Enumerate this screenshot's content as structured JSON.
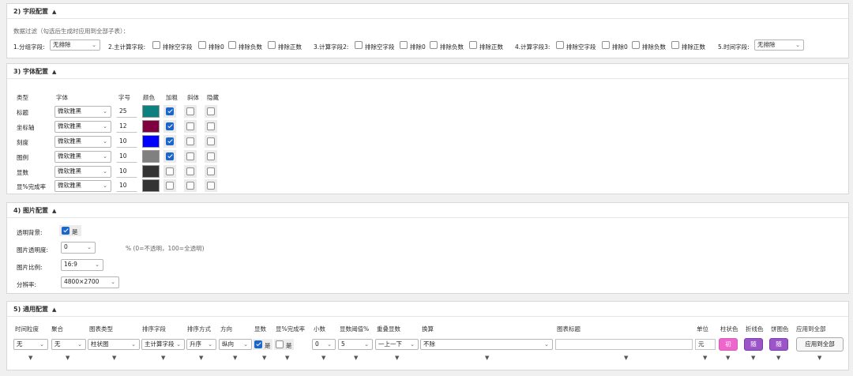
{
  "field_config": {
    "title": "2) 字段配置",
    "toggle": "▲",
    "filter_note": "数据过滤（勾选后生成时应用到全部子表）：",
    "group_field": {
      "label": "1.分组字段:",
      "value": "无排除"
    },
    "calc1": {
      "label": "2.主计算字段:",
      "options": [
        "排除空字段",
        "排除0",
        "排除负数",
        "排除正数"
      ]
    },
    "calc2": {
      "label": "3.计算字段2:",
      "options": [
        "排除空字段",
        "排除0",
        "排除负数",
        "排除正数"
      ]
    },
    "calc3": {
      "label": "4.计算字段3:",
      "options": [
        "排除空字段",
        "排除0",
        "排除负数",
        "排除正数"
      ]
    },
    "time_field": {
      "label": "5.时间字段:",
      "value": "无排除"
    }
  },
  "font_config": {
    "title": "3) 字体配置",
    "toggle": "▲",
    "headers": {
      "type": "类型",
      "font": "字体",
      "size": "字号",
      "color": "颜色",
      "bold": "加粗",
      "italic": "斜体",
      "hide": "隐藏"
    },
    "rows": [
      {
        "type": "标题",
        "font": "微软雅黑",
        "size": "25",
        "color": "#0f8080",
        "bold": true,
        "italic": false,
        "hide": false
      },
      {
        "type": "坐标轴",
        "font": "微软雅黑",
        "size": "12",
        "color": "#800040",
        "bold": true,
        "italic": false,
        "hide": false
      },
      {
        "type": "刻度",
        "font": "微软雅黑",
        "size": "10",
        "color": "#0000ff",
        "bold": true,
        "italic": false,
        "hide": false
      },
      {
        "type": "图例",
        "font": "微软雅黑",
        "size": "10",
        "color": "#808080",
        "bold": true,
        "italic": false,
        "hide": false
      },
      {
        "type": "显数",
        "font": "微软雅黑",
        "size": "10",
        "color": "#333333",
        "bold": false,
        "italic": false,
        "hide": false
      },
      {
        "type": "显%完成率",
        "font": "微软雅黑",
        "size": "10",
        "color": "#333333",
        "bold": false,
        "italic": false,
        "hide": false
      }
    ]
  },
  "image_config": {
    "title": "4) 图片配置",
    "toggle": "▲",
    "transparent_label": "透明背景:",
    "transparent_value": "是",
    "opacity_label": "图片透明度:",
    "opacity_value": "0",
    "opacity_note": "% (0=不透明，100=全透明)",
    "ratio_label": "图片比例:",
    "ratio_value": "16:9",
    "resolution_label": "分辨率:",
    "resolution_value": "4800×2700"
  },
  "general_config": {
    "title": "5) 通用配置",
    "toggle": "▲",
    "headers": {
      "granularity": "时间粒度",
      "aggregate": "聚合",
      "chart_type": "图表类型",
      "sort_field": "排序字段",
      "sort_order": "排序方式",
      "direction": "方向",
      "show_num": "显数",
      "show_pct": "显%完成率",
      "decimals": "小数",
      "num_threshold": "显数阈值%",
      "overlap": "重叠显数",
      "convert": "换算",
      "chart_title": "图表标题",
      "unit": "单位",
      "bar_color": "柱状色",
      "line_color": "折线色",
      "pie_color": "饼图色",
      "apply_all": "应用到全部"
    },
    "values": {
      "granularity": "无",
      "aggregate": "无",
      "chart_type": "柱状图",
      "sort_field": "主计算字段",
      "sort_order": "升序",
      "direction": "纵向",
      "show_num": "是",
      "show_pct": "是",
      "decimals": "0",
      "num_threshold": "5",
      "overlap": "一上一下",
      "convert": "不除",
      "chart_title": "",
      "unit": "元",
      "bar_btn": "初",
      "line_btn": "随",
      "pie_btn": "随",
      "apply_btn": "应用到全部"
    },
    "bar_color": "#ee66cc",
    "line_color": "#9b55c8",
    "pie_color": "#9b55c8",
    "down_arrow": "▼"
  }
}
